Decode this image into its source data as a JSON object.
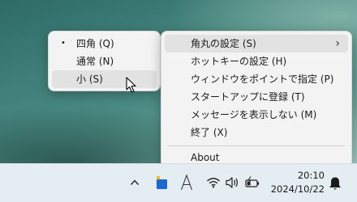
{
  "left_menu": {
    "items": [
      {
        "label": "四角 (Q)",
        "checked": true
      },
      {
        "label": "通常 (N)",
        "checked": false
      },
      {
        "label": "小 (S)",
        "checked": false
      }
    ],
    "bullet": "•"
  },
  "right_menu": {
    "items": [
      {
        "label": "角丸の設定 (S)",
        "has_submenu": true
      },
      {
        "label": "ホットキーの設定 (H)"
      },
      {
        "label": "ウィンドウをポイントで指定 (P)"
      },
      {
        "label": "スタートアップに登録 (T)"
      },
      {
        "label": "メッセージを表示しない (M)"
      },
      {
        "label": "終了 (X)"
      },
      {
        "label": "About"
      }
    ],
    "submenu_arrow": "›"
  },
  "taskbar": {
    "chevron_icon": "chevron-up-icon",
    "tray_app_icon": "blue-square-app-icon",
    "ime_indicator": "A",
    "wifi_icon": "wifi-icon",
    "speaker_icon": "speaker-icon",
    "battery_icon": "battery-charging-icon",
    "notification_icon": "bell-icon"
  },
  "clock": {
    "time": "20:10",
    "date": "2024/10/22"
  },
  "colors": {
    "menu_background": "#f3f3f3",
    "hover_highlight": "#e2e2e2",
    "taskbar_background": "#e4edf1",
    "tray_app_accent": "#1e66d0"
  }
}
